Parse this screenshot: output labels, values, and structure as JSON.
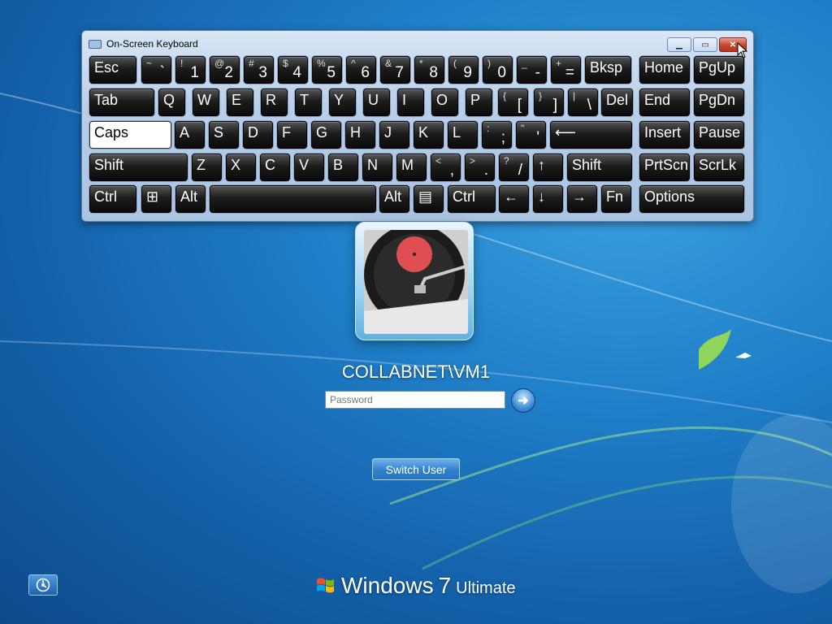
{
  "osk": {
    "title": "On-Screen Keyboard",
    "rows": [
      [
        {
          "main": "Esc"
        },
        {
          "top": "~",
          "bot": "`"
        },
        {
          "top": "!",
          "bot": "1"
        },
        {
          "top": "@",
          "bot": "2"
        },
        {
          "top": "#",
          "bot": "3"
        },
        {
          "top": "$",
          "bot": "4"
        },
        {
          "top": "%",
          "bot": "5"
        },
        {
          "top": "^",
          "bot": "6"
        },
        {
          "top": "&",
          "bot": "7"
        },
        {
          "top": "*",
          "bot": "8"
        },
        {
          "top": "(",
          "bot": "9"
        },
        {
          "top": ")",
          "bot": "0"
        },
        {
          "top": "_",
          "bot": "-"
        },
        {
          "top": "+",
          "bot": "="
        },
        {
          "main": "Bksp"
        },
        {
          "main": "Home"
        },
        {
          "main": "PgUp"
        }
      ],
      [
        {
          "main": "Tab"
        },
        {
          "main": "Q"
        },
        {
          "main": "W"
        },
        {
          "main": "E"
        },
        {
          "main": "R"
        },
        {
          "main": "T"
        },
        {
          "main": "Y"
        },
        {
          "main": "U"
        },
        {
          "main": "I"
        },
        {
          "main": "O"
        },
        {
          "main": "P"
        },
        {
          "top": "{",
          "bot": "["
        },
        {
          "top": "}",
          "bot": "]"
        },
        {
          "top": "|",
          "bot": "\\"
        },
        {
          "main": "Del"
        },
        {
          "main": "End"
        },
        {
          "main": "PgDn"
        }
      ],
      [
        {
          "main": "Caps"
        },
        {
          "main": "A"
        },
        {
          "main": "S"
        },
        {
          "main": "D"
        },
        {
          "main": "F"
        },
        {
          "main": "G"
        },
        {
          "main": "H"
        },
        {
          "main": "J"
        },
        {
          "main": "K"
        },
        {
          "main": "L"
        },
        {
          "top": ":",
          "bot": ";"
        },
        {
          "top": "\"",
          "bot": "'"
        },
        {
          "main": "⟵"
        },
        {
          "main": "Insert"
        },
        {
          "main": "Pause"
        }
      ],
      [
        {
          "main": "Shift"
        },
        {
          "main": "Z"
        },
        {
          "main": "X"
        },
        {
          "main": "C"
        },
        {
          "main": "V"
        },
        {
          "main": "B"
        },
        {
          "main": "N"
        },
        {
          "main": "M"
        },
        {
          "top": "<",
          "bot": ","
        },
        {
          "top": ">",
          "bot": "."
        },
        {
          "top": "?",
          "bot": "/"
        },
        {
          "main": "↑"
        },
        {
          "main": "Shift"
        },
        {
          "main": "PrtScn"
        },
        {
          "main": "ScrLk"
        }
      ],
      [
        {
          "main": "Ctrl"
        },
        {
          "main": "⊞"
        },
        {
          "main": "Alt"
        },
        {
          "main": ""
        },
        {
          "main": "Alt"
        },
        {
          "main": "▤"
        },
        {
          "main": "Ctrl"
        },
        {
          "main": "←"
        },
        {
          "main": "↓"
        },
        {
          "main": "→"
        },
        {
          "main": "Fn"
        },
        {
          "main": "Options"
        }
      ]
    ]
  },
  "login": {
    "username": "COLLABNET\\VM1",
    "password_placeholder": "Password",
    "switch_user_label": "Switch User"
  },
  "branding": {
    "windows": "Windows",
    "version": "7",
    "edition": "Ultimate"
  },
  "icons": {
    "ease_of_access": "ease-of-access-icon",
    "go_arrow": "submit-arrow-icon"
  },
  "colors": {
    "accent": "#1f7fc8"
  }
}
